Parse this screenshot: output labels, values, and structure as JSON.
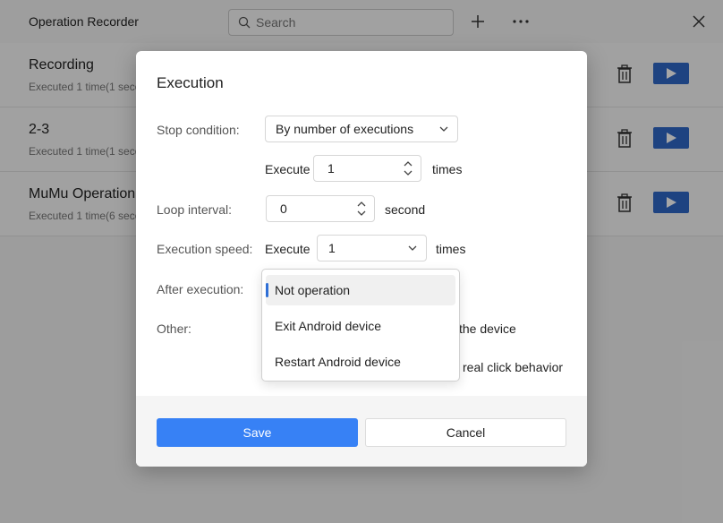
{
  "app": {
    "title": "Operation Recorder",
    "search_placeholder": "Search",
    "accent_color": "#3781f5"
  },
  "recordings": [
    {
      "title": "Recording",
      "subtitle": "Executed 1 time(1 seco"
    },
    {
      "title": "2-3",
      "subtitle": "Executed 1 time(1 seco"
    },
    {
      "title": "MuMu Operation",
      "subtitle": "Executed 1 time(6 seco"
    }
  ],
  "dialog": {
    "title": "Execution",
    "stop_condition_label": "Stop condition:",
    "stop_condition_value": "By number of executions",
    "execute_label": "Execute",
    "execute_count": "1",
    "times_label": "times",
    "loop_interval_label": "Loop interval:",
    "loop_interval_value": "0",
    "second_label": "second",
    "execution_speed_label": "Execution speed:",
    "speed_execute_label": "Execute",
    "speed_value": "1",
    "speed_times_label": "times",
    "after_execution_label": "After execution:",
    "other_label": "Other:",
    "other_option_1_tail": "the device",
    "other_option_2_tail": "real click behavior",
    "save_label": "Save",
    "cancel_label": "Cancel"
  },
  "dropdown": {
    "options": [
      "Not operation",
      "Exit Android device",
      "Restart Android device"
    ],
    "selected": "Not operation"
  }
}
